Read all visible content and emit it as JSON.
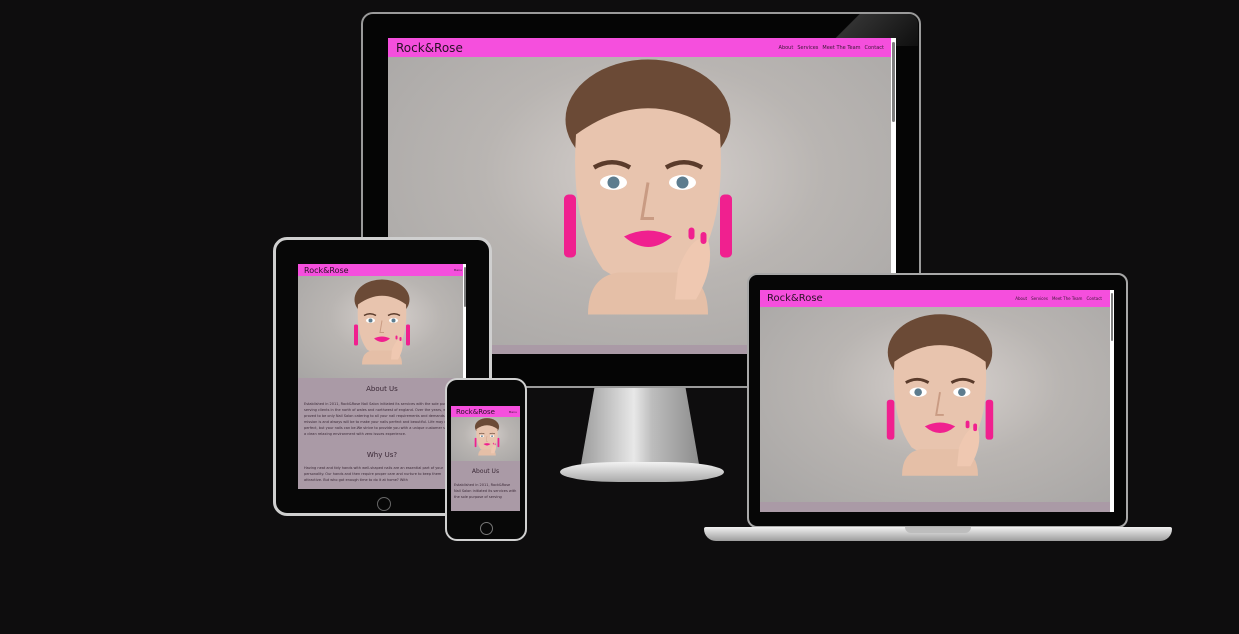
{
  "site": {
    "brand": "Rock&Rose",
    "nav_links": [
      "About",
      "Services",
      "Meet The Team",
      "Contact"
    ],
    "menu_label": "Menu",
    "about_heading": "About Us",
    "why_heading": "Why Us?",
    "about_text": "Established in 2011, Rock&Rose Nail Salon initiated its services with the sole purpose of serving clients in the north of wales and northwest of england. Over the years, we have proved to be only Nail Salon catering to all your nail requirements and demands.Our mission is and always will be to make your nails perfect and beautiful. Life may not be perfect, but your nails can be.We strive to provide you with a unique customer service in a clean relaxing environment with zero issues experience.",
    "why_text": "Having neat and tidy hands with well-shaped nails are an essential part of your personality. Our hands and then require proper care and nurture to keep them attractive. But who got enough time to do it at home? With",
    "phone_about_text": "Established in 2011, Rock&Rose Nail Salon initiated its services with the sole purpose of serving"
  },
  "colors": {
    "background": "#0e0d0e",
    "nav_pink": "#f54fdd",
    "section_mauve": "#aa9aa6",
    "lipstick": "#f0208f"
  }
}
